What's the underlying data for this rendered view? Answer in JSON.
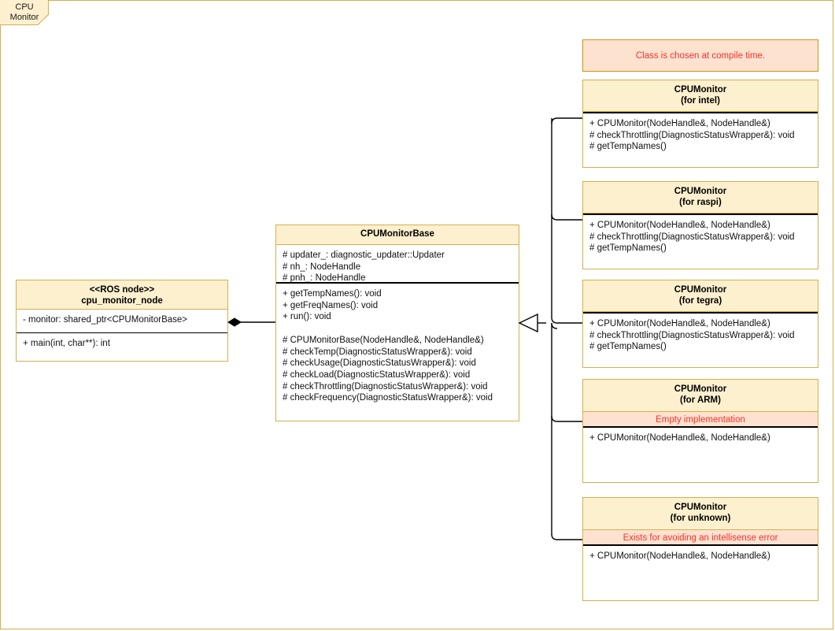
{
  "frame": {
    "tab_label": "CPU\nMonitor",
    "border_color": "#d4af4e",
    "tab_fill": "#fdf0ce"
  },
  "palette": {
    "header_fill": "#fdf0ce",
    "box_border": "#d4af4e",
    "note_fill": "#fde3cf",
    "note_border": "#d4900e",
    "note_text": "#ff2d2d",
    "body_fill": "#ffffff",
    "divider": "#000000",
    "text": "#111111"
  },
  "diagram": {
    "type": "uml-class-diagram",
    "title": "CPU Monitor"
  },
  "note": {
    "name": "compile-time-note",
    "text": "Class is chosen at compile time."
  },
  "ros_node": {
    "stereotype": "<<ROS node>>",
    "name": "cpu_monitor_node",
    "header": "<<ROS node>>\ncpu_monitor_node",
    "attributes": "- monitor: shared_ptr<CPUMonitorBase>",
    "operations": "+ main(int, char**): int"
  },
  "base_class": {
    "name": "CPUMonitorBase",
    "attributes": "# updater_: diagnostic_updater::Updater\n# nh_: NodeHandle\n# pnh_: NodeHandle",
    "operations": "+ getTempNames(): void\n+ getFreqNames(): void\n+ run(): void\n\n# CPUMonitorBase(NodeHandle&, NodeHandle&)\n# checkTemp(DiagnosticStatusWrapper&): void\n# checkUsage(DiagnosticStatusWrapper&): void\n# checkLoad(DiagnosticStatusWrapper&): void\n# checkThrottling(DiagnosticStatusWrapper&): void\n# checkFrequency(DiagnosticStatusWrapper&): void"
  },
  "subclasses": [
    {
      "id": "intel",
      "name": "CPUMonitor",
      "variant": "(for intel)",
      "header": "CPUMonitor\n(for intel)",
      "note": null,
      "operations": "+ CPUMonitor(NodeHandle&, NodeHandle&)\n# checkThrottling(DiagnosticStatusWrapper&): void\n# getTempNames()"
    },
    {
      "id": "raspi",
      "name": "CPUMonitor",
      "variant": "(for raspi)",
      "header": "CPUMonitor\n(for raspi)",
      "note": null,
      "operations": "+ CPUMonitor(NodeHandle&, NodeHandle&)\n# checkThrottling(DiagnosticStatusWrapper&): void\n# getTempNames()"
    },
    {
      "id": "tegra",
      "name": "CPUMonitor",
      "variant": "(for tegra)",
      "header": "CPUMonitor\n(for tegra)",
      "note": null,
      "operations": "+ CPUMonitor(NodeHandle&, NodeHandle&)\n# checkThrottling(DiagnosticStatusWrapper&): void\n# getTempNames()"
    },
    {
      "id": "arm",
      "name": "CPUMonitor",
      "variant": "(for ARM)",
      "header": "CPUMonitor\n(for ARM)",
      "note": "Empty implementation",
      "operations": "+ CPUMonitor(NodeHandle&, NodeHandle&)"
    },
    {
      "id": "unknown",
      "name": "CPUMonitor",
      "variant": "(for unknown)",
      "header": "CPUMonitor\n(for unknown)",
      "note": "Exists for avoiding an intellisense error",
      "operations": "+ CPUMonitor(NodeHandle&, NodeHandle&)"
    }
  ],
  "relations": [
    {
      "id": "composition",
      "kind": "composition",
      "from": "cpu_monitor_node",
      "to": "CPUMonitorBase"
    },
    {
      "id": "generalization",
      "kind": "generalization",
      "from": "CPUMonitor",
      "to": "CPUMonitorBase"
    }
  ]
}
